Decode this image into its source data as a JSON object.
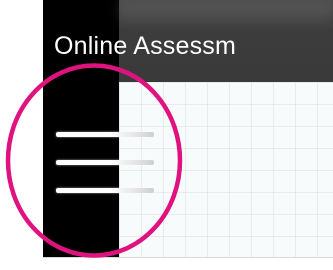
{
  "app": {
    "title": "Online Assessm"
  },
  "menu": {
    "icon": "hamburger-menu-icon"
  },
  "annotation": {
    "shape": "circle",
    "color": "#e0127f"
  },
  "colors": {
    "header_bg": "#3c3c3c",
    "sidebar_edge": "#000000",
    "content_bg": "#f8fbfb",
    "title_text": "#ffffff"
  }
}
